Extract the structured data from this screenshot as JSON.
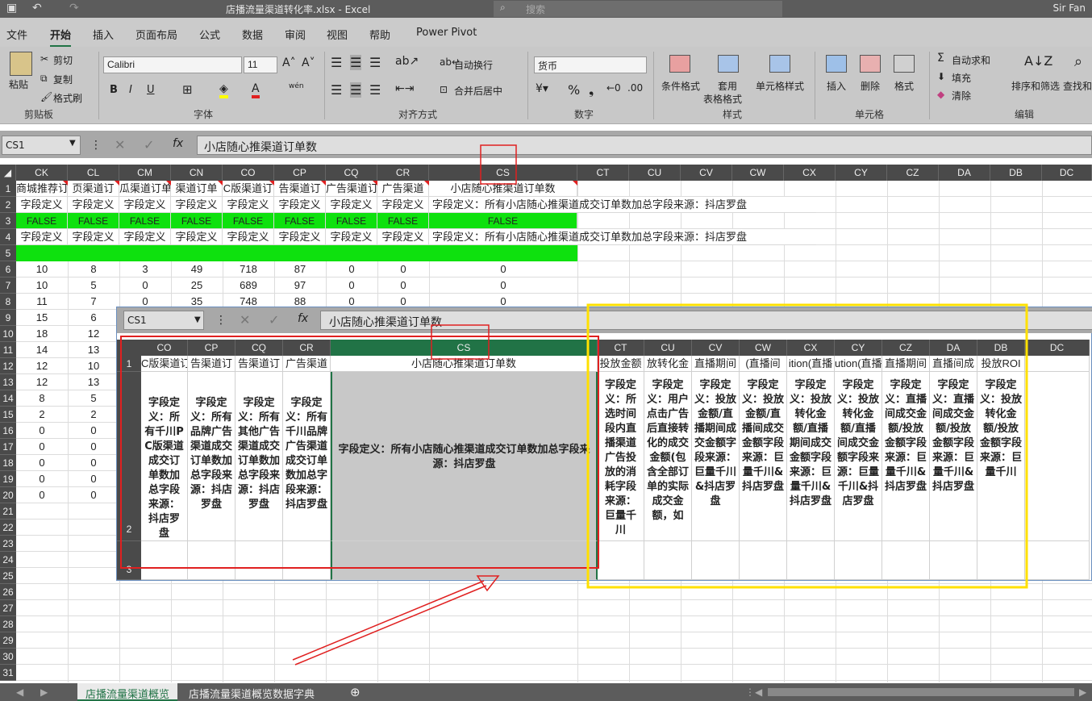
{
  "titlebar": {
    "filename": "店播流量渠道转化率.xlsx - Excel",
    "search": "搜索",
    "user": "Sir Fan"
  },
  "tabs": [
    "文件",
    "开始",
    "插入",
    "页面布局",
    "公式",
    "数据",
    "审阅",
    "视图",
    "帮助",
    "Power Pivot"
  ],
  "ribbon": {
    "paste": "粘贴",
    "cut": "剪切",
    "copy": "复制",
    "format_painter": "格式刷",
    "clipboard": "剪贴板",
    "font_name": "Calibri",
    "font_size": "11",
    "bold": "B",
    "italic": "I",
    "underline": "U",
    "font_group": "字体",
    "wrap_text": "自动换行",
    "merge_center": "合并后居中",
    "align_group": "对齐方式",
    "number_format": "货币",
    "number_group": "数字",
    "cond_format": "条件格式",
    "table_format_1": "套用",
    "table_format_2": "表格格式",
    "cell_styles": "单元格样式",
    "styles_group": "样式",
    "insert": "插入",
    "delete": "删除",
    "format": "格式",
    "cells_group": "单元格",
    "autosum": "自动求和",
    "fill": "填充",
    "clear": "清除",
    "sort_filter": "排序和筛选",
    "find_select": "查找和",
    "edit_group": "编辑",
    "wen": "wén"
  },
  "formula": {
    "name_box": "CS1",
    "content": "小店随心推渠道订单数"
  },
  "columns": [
    "CK",
    "CL",
    "CM",
    "CN",
    "CO",
    "CP",
    "CQ",
    "CR",
    "CS",
    "CT",
    "CU",
    "CV",
    "CW",
    "CX",
    "CY",
    "CZ",
    "DA",
    "DB",
    "DC"
  ],
  "rows": [
    "1",
    "2",
    "3",
    "4",
    "5",
    "6",
    "7",
    "8",
    "9",
    "10",
    "11",
    "12",
    "13",
    "14",
    "15",
    "16",
    "17",
    "18",
    "19",
    "20",
    "21",
    "22",
    "23",
    "24",
    "25",
    "26",
    "27",
    "28",
    "29",
    "30",
    "31"
  ],
  "row1": [
    "商城推荐订",
    "页渠道订",
    "瓜渠道订单",
    "渠道订单",
    "C版渠道订",
    "告渠道订",
    "广告渠道订",
    "广告渠道",
    "小店随心推渠道订单数"
  ],
  "row2_short": "字段定义",
  "row2_cs": "字段定义：所有小店随心推渠道成交订单数加总字段来源：抖店罗盘",
  "false_val": "FALSE",
  "data_rows": [
    [
      "10",
      "8",
      "3",
      "49",
      "718",
      "87",
      "0",
      "0",
      "0"
    ],
    [
      "10",
      "5",
      "0",
      "25",
      "689",
      "97",
      "0",
      "0",
      "0"
    ],
    [
      "11",
      "7",
      "0",
      "35",
      "748",
      "88",
      "0",
      "0",
      "0"
    ],
    [
      "15",
      "6"
    ],
    [
      "18",
      "12"
    ],
    [
      "14",
      "13"
    ],
    [
      "12",
      "10"
    ],
    [
      "12",
      "13"
    ],
    [
      "8",
      "5"
    ],
    [
      "2",
      "2"
    ],
    [
      "0",
      "0"
    ],
    [
      "0",
      "0"
    ],
    [
      "0",
      "0"
    ],
    [
      "0",
      "0"
    ],
    [
      "0",
      "0"
    ]
  ],
  "inset": {
    "name_box": "CS1",
    "content": "小店随心推渠道订单数",
    "columns": [
      "CO",
      "CP",
      "CQ",
      "CR",
      "CS",
      "CT",
      "CU",
      "CV",
      "CW",
      "CX",
      "CY",
      "CZ",
      "DA",
      "DB",
      "DC"
    ],
    "head": [
      "C版渠道订",
      "告渠道订",
      "告渠道订",
      "广告渠道",
      "小店随心推渠道订单数",
      "投放金额",
      "放转化金",
      "直播期间",
      "(直播间",
      "ition(直播",
      "ution(直播",
      "直播期间",
      "直播间成",
      "投放ROI",
      ""
    ],
    "defs": [
      "字段定义：所有千川PC版渠道成交订单数加总字段来源：抖店罗盘",
      "字段定义：所有品牌广告渠道成交订单数加总字段来源：抖店罗盘",
      "字段定义：所有其他广告渠道成交订单数加总字段来源：抖店罗盘",
      "字段定义：所有千川品牌广告渠道成交订单数加总字段来源：抖店罗盘",
      "字段定义：所有小店随心推渠道成交订单数加总字段来源：抖店罗盘",
      "字段定义：所选时间段内直播渠道广告投放的消耗字段来源：巨量千川",
      "字段定义：用户点击广告后直接转化的成交金额(包含全部订单的实际成交金额，如",
      "字段定义：投放金额/直播期间成交金额字段来源：巨量千川&抖店罗盘",
      "字段定义：投放金额/直播间成交金额字段来源：巨量千川&抖店罗盘",
      "字段定义：投放转化金额/直播期间成交金额字段来源：巨量千川&抖店罗盘",
      "字段定义：投放转化金额/直播间成交金额字段来源：巨量千川&抖店罗盘",
      "字段定义：直播间成交金额/投放金额字段来源：巨量千川&抖店罗盘",
      "字段定义：直播间成交金额/投放金额字段来源：巨量千川&抖店罗盘",
      "字段定义：投放转化金额/投放金额字段来源：巨量千川",
      ""
    ],
    "rows": [
      "1",
      "2",
      "3"
    ]
  },
  "sheets": [
    "店播流量渠道概览",
    "店播流量渠道概览数据字典"
  ]
}
